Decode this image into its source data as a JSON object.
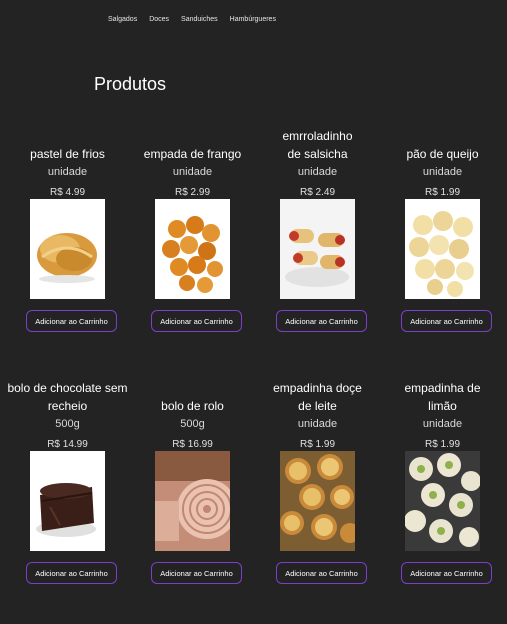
{
  "nav": {
    "items": [
      "Salgados",
      "Doces",
      "Sanduiches",
      "Hambúrgueres"
    ]
  },
  "page": {
    "title": "Produtos"
  },
  "products": [
    {
      "name": "pastel de frios",
      "unit": "unidade",
      "price": "R$ 4.99",
      "button": "Adicionar ao Carrinho",
      "image": "pastel-image"
    },
    {
      "name": "empada de frango",
      "unit": "unidade",
      "price": "R$ 2.99",
      "button": "Adicionar ao Carrinho",
      "image": "empada-image"
    },
    {
      "name": "emrroladinho de salsicha",
      "unit": "unidade",
      "price": "R$ 2.49",
      "button": "Adicionar ao Carrinho",
      "image": "enroladinho-image"
    },
    {
      "name": "pão de queijo",
      "unit": "unidade",
      "price": "R$ 1.99",
      "button": "Adicionar ao Carrinho",
      "image": "pao-de-queijo-image"
    },
    {
      "name": "bolo de chocolate sem recheio",
      "unit": "500g",
      "price": "R$ 14.99",
      "button": "Adicionar ao Carrinho",
      "image": "bolo-chocolate-image"
    },
    {
      "name": "bolo de rolo",
      "unit": "500g",
      "price": "R$ 16.99",
      "button": "Adicionar ao Carrinho",
      "image": "bolo-de-rolo-image"
    },
    {
      "name": "empadinha doçe de leite",
      "unit": "unidade",
      "price": "R$ 1.99",
      "button": "Adicionar ao Carrinho",
      "image": "empadinha-doce-image"
    },
    {
      "name": "empadinha de limão",
      "unit": "unidade",
      "price": "R$ 1.99",
      "button": "Adicionar ao Carrinho",
      "image": "empadinha-limao-image"
    }
  ]
}
